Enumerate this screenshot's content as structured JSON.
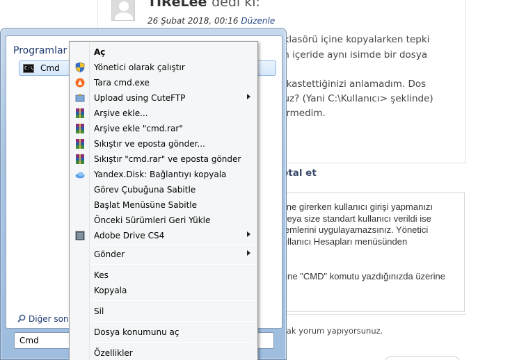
{
  "page": {
    "author": "TİReLee",
    "said": "dedi ki:",
    "date": "26 Şubat 2018, 00:16",
    "edit": "Düzenle",
    "lines": [
      ". klasörü içine kopyalarken tepki",
      "en içeride aynı isimde bir dosya",
      "e kastettiğinizi anlamadım. Dos",
      "nuz? (Yani C:\\Kullanıcı> şeklinde)",
      "girmedim."
    ],
    "cancel_reply": "iptal et",
    "reply_lines": [
      "line girerken kullanıcı girişi yapmanızı",
      "veya size standart kullanıcı verildi ise",
      "lemlerini uygulayamazsınız. Yönetici",
      "ullanıcı Hesapları menüsünden",
      "üne \"CMD\" komutu yazdığınızda üzerine"
    ],
    "logged_in": "arak yorum yapıyorsunuz."
  },
  "start_menu": {
    "programs_title": "Programlar (",
    "program_item": "Cmd",
    "cmd_icon_text": "C:\\",
    "more_results": "Diğer sonuç",
    "search_value": "Cmd"
  },
  "context_menu": {
    "items": [
      {
        "label": "Aç",
        "bold": true,
        "icon": "none"
      },
      {
        "label": "Yönetici olarak çalıştır",
        "icon": "uac-shield-icon"
      },
      {
        "label": "Tara cmd.exe",
        "icon": "avast-icon"
      },
      {
        "label": "Upload using CuteFTP",
        "icon": "cuteftp-icon",
        "submenu": true
      },
      {
        "label": "Arşive ekle...",
        "icon": "winrar-icon"
      },
      {
        "label": "Arşive ekle \"cmd.rar\"",
        "icon": "winrar-icon"
      },
      {
        "label": "Sıkıştır ve eposta gönder...",
        "icon": "winrar-icon"
      },
      {
        "label": "Sıkıştır \"cmd.rar\" ve eposta gönder",
        "icon": "winrar-icon"
      },
      {
        "label": "Yandex.Disk: Bağlantıyı kopyala",
        "icon": "yandex-disk-icon"
      },
      {
        "label": "Görev Çubuğuna Sabitle",
        "icon": "none"
      },
      {
        "label": "Başlat Menüsüne Sabitle",
        "icon": "none"
      },
      {
        "label": "Önceki Sürümleri Geri Yükle",
        "icon": "none"
      },
      {
        "label": "Adobe Drive CS4",
        "icon": "adobe-drive-icon",
        "submenu": true
      },
      {
        "label": "Gönder",
        "icon": "none",
        "submenu": true
      },
      {
        "label": "Kes",
        "icon": "none"
      },
      {
        "label": "Kopyala",
        "icon": "none"
      },
      {
        "label": "Sil",
        "icon": "none"
      },
      {
        "label": "Dosya konumunu aç",
        "icon": "none"
      },
      {
        "label": "Özellikler",
        "icon": "none"
      }
    ]
  },
  "colors": {
    "start_menu_bg": "#a8c4e2",
    "selection": "#d6e8fb",
    "menu_bg": "#f5f6f7",
    "link_blue": "#1e3a6e"
  }
}
